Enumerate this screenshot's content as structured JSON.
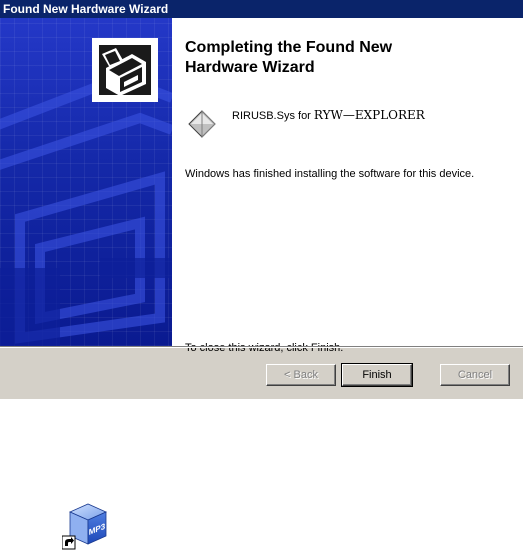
{
  "window": {
    "title": "Found New Hardware Wizard"
  },
  "wizard": {
    "heading_line1": "Completing the Found New",
    "heading_line2": "Hardware Wizard",
    "device_prefix": "RIRUSB.Sys for ",
    "device_name": "RYW—EXPLORER",
    "finished_message": "Windows has finished installing the software for this device.",
    "close_message": "To close this wizard, click Finish."
  },
  "buttons": {
    "back": "< Back",
    "finish": "Finish",
    "cancel": "Cancel"
  },
  "desktop": {
    "shortcut_icon": "mp3-shortcut-icon",
    "shortcut_badge": "MP3"
  },
  "colors": {
    "titlebar": "#0a246a",
    "side_panel": "#1c2aa8",
    "dialog_face": "#d4d0c8"
  }
}
